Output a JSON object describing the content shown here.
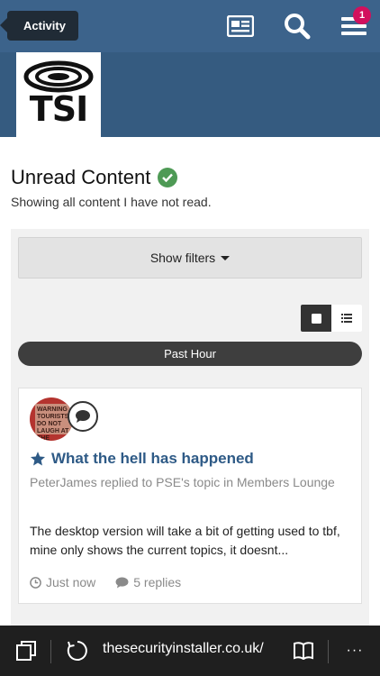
{
  "header": {
    "activity_label": "Activity",
    "notification_count": "1",
    "logo_text": "TSI"
  },
  "page": {
    "title": "Unread Content",
    "subtitle": "Showing all content I have not read."
  },
  "filters": {
    "show_filters_label": "Show filters"
  },
  "time_group": "Past Hour",
  "item": {
    "avatar_text": "WARNING TOURISTS DO NOT LAUGH AT THE NATIVES",
    "title": "What the hell has happened",
    "meta": "PeterJames replied to PSE's topic in Members Lounge",
    "snippet": "The desktop version will take a bit of getting used to tbf, mine only shows the current topics, it doesnt...",
    "time": "Just now",
    "replies": "5 replies"
  },
  "browser": {
    "url": "thesecurityinstaller.co.uk/",
    "more_label": "···"
  },
  "colors": {
    "header": "#3c638b",
    "accent": "#2e5a86",
    "badge": "#d2105d",
    "check": "#4e9a55"
  }
}
